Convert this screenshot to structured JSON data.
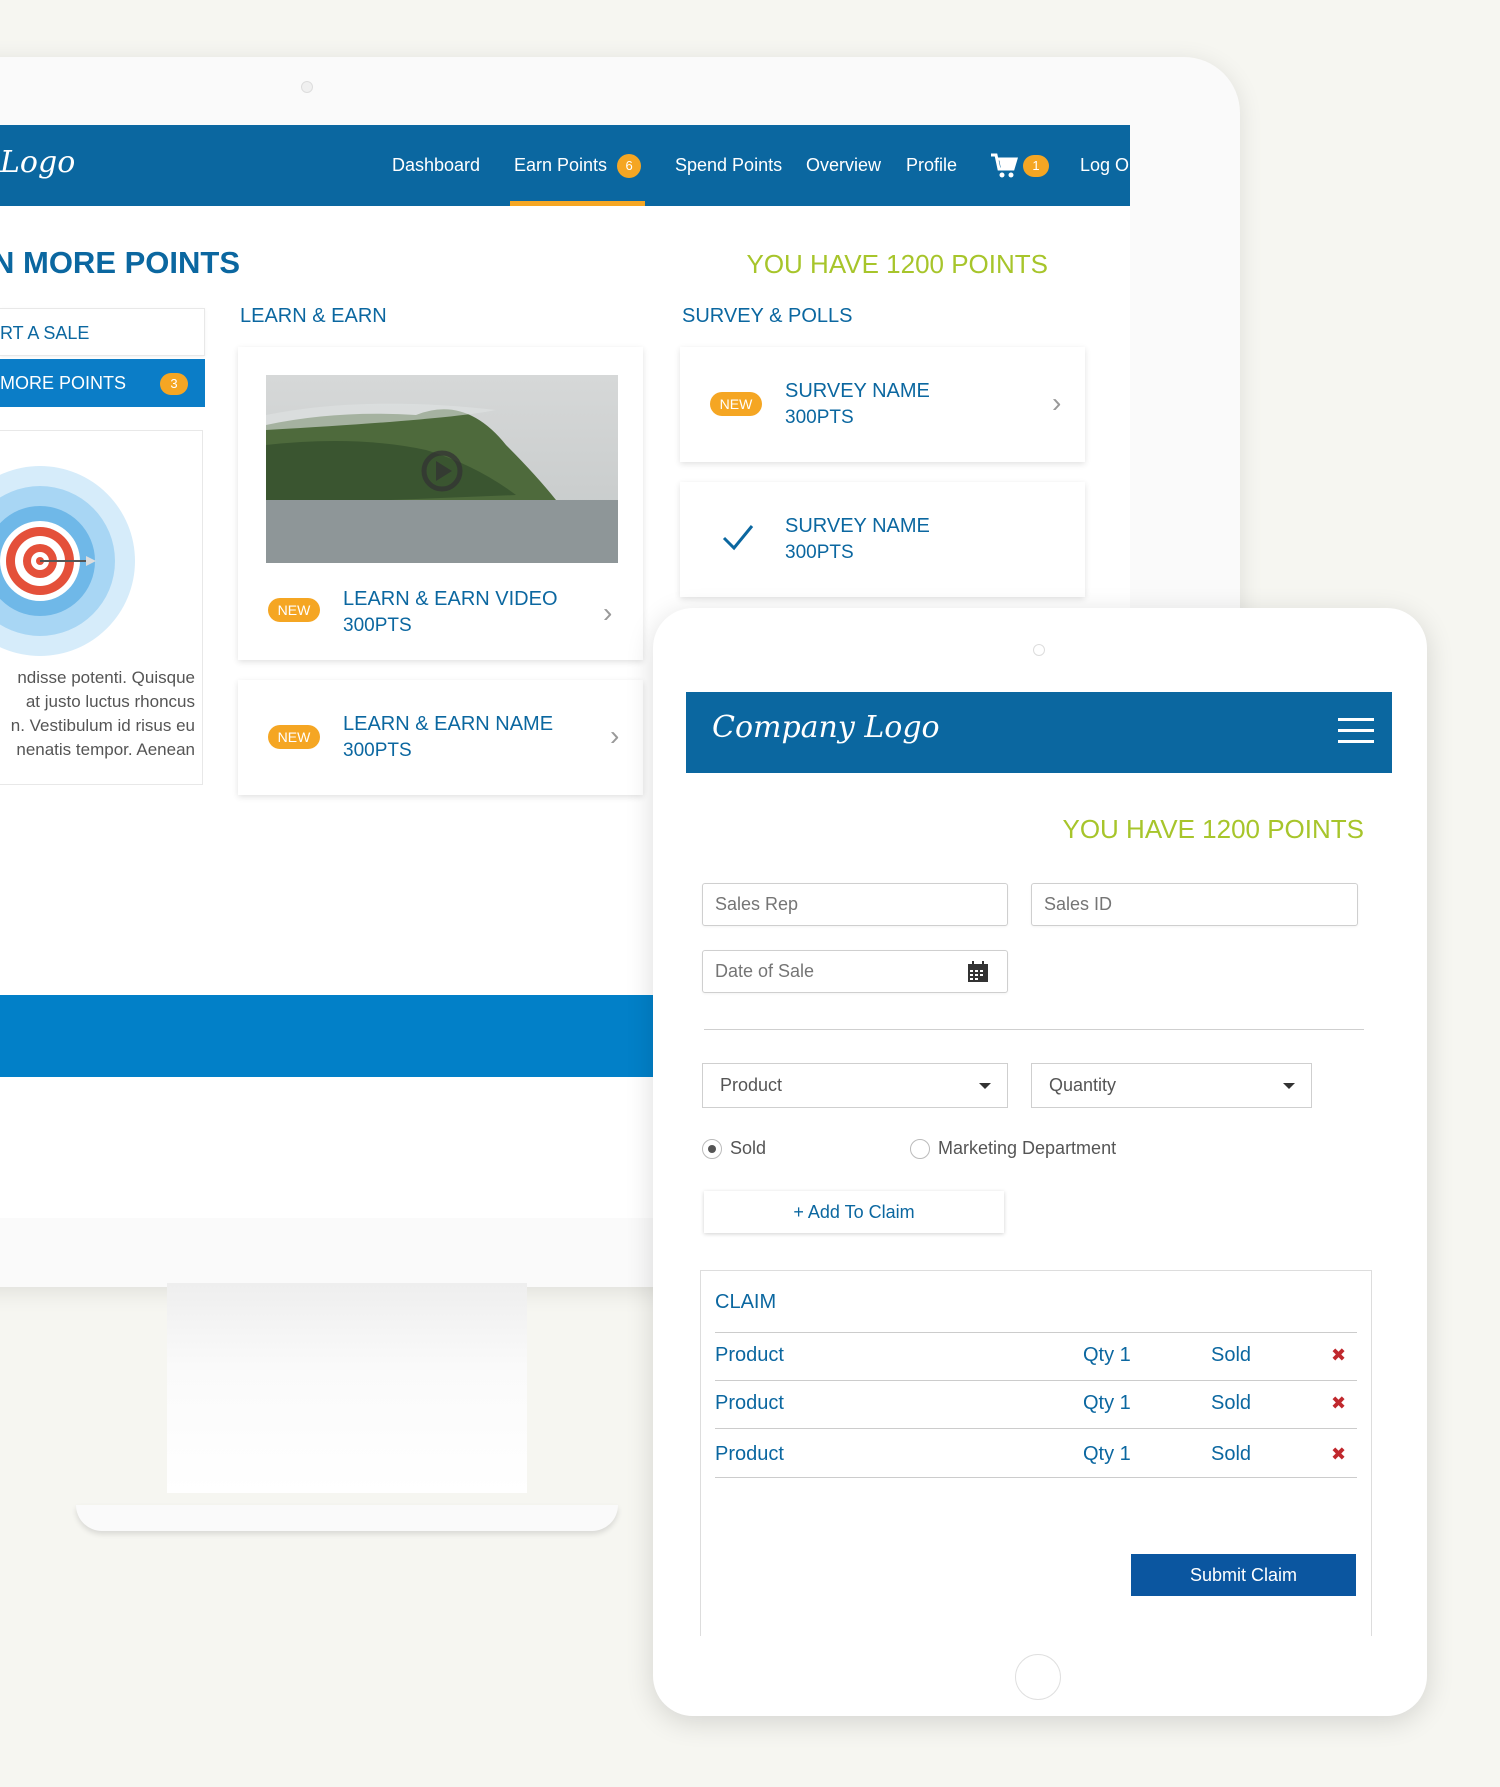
{
  "desktop": {
    "logo": "Logo",
    "nav": {
      "items": [
        {
          "label": "Dashboard"
        },
        {
          "label": "Earn Points",
          "badge": "6"
        },
        {
          "label": "Spend Points"
        },
        {
          "label": "Overview"
        },
        {
          "label": "Profile"
        }
      ],
      "cart_badge": "1",
      "logout": "Log Out"
    },
    "page_title": "N MORE POINTS",
    "points": "YOU HAVE 1200 POINTS",
    "sidebar": {
      "report_tab": "RT A SALE",
      "earn_tab": "MORE POINTS",
      "earn_badge": "3",
      "text_lines": [
        "ndisse potenti. Quisque",
        "at justo luctus rhoncus",
        "n. Vestibulum id risus eu",
        "nenatis tempor. Aenean"
      ]
    },
    "learn": {
      "title": "LEARN & EARN",
      "cards": [
        {
          "badge": "NEW",
          "title": "LEARN & EARN VIDEO",
          "pts": "300PTS"
        },
        {
          "badge": "NEW",
          "title": "LEARN & EARN NAME",
          "pts": "300PTS"
        }
      ]
    },
    "survey": {
      "title": "SURVEY & POLLS",
      "cards": [
        {
          "badge": "NEW",
          "title": "SURVEY NAME",
          "pts": "300PTS"
        },
        {
          "title": "SURVEY NAME",
          "pts": "300PTS"
        }
      ]
    }
  },
  "tablet": {
    "logo": "Company Logo",
    "points": "YOU HAVE 1200 POINTS",
    "form": {
      "sales_rep_placeholder": "Sales Rep",
      "sales_id_placeholder": "Sales ID",
      "date_placeholder": "Date of Sale",
      "product": "Product",
      "quantity": "Quantity",
      "radio_sold": "Sold",
      "radio_marketing": "Marketing Department",
      "add_button": "+  Add To Claim"
    },
    "claim": {
      "title": "CLAIM",
      "rows": [
        {
          "product": "Product",
          "qty": "Qty 1",
          "status": "Sold"
        },
        {
          "product": "Product",
          "qty": "Qty 1",
          "status": "Sold"
        },
        {
          "product": "Product",
          "qty": "Qty 1",
          "status": "Sold"
        }
      ],
      "submit": "Submit Claim"
    }
  }
}
